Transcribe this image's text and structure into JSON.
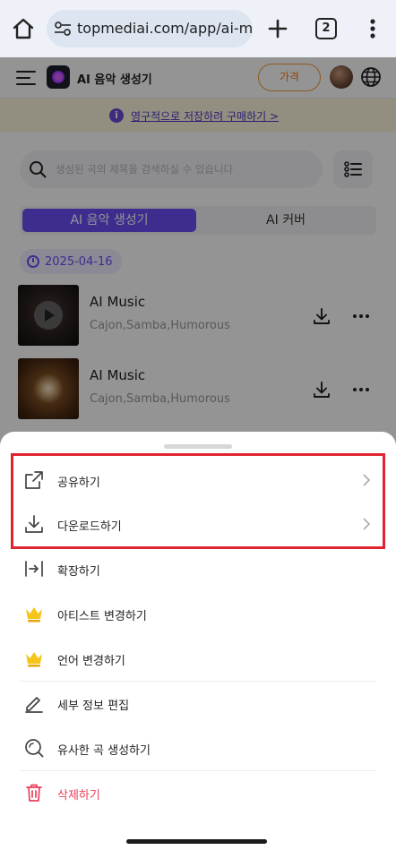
{
  "browser": {
    "url": "topmediai.com/app/ai-m",
    "tab_count": "2"
  },
  "app": {
    "title": "AI 음악 생성기",
    "price_button": "가격",
    "banner_text": "영구적으로 저장하려 구매하기 >",
    "search_placeholder": "생성된 곡의 제목을 검색하실 수 있습니다",
    "tabs": [
      {
        "label": "AI 음악 생성기",
        "active": true
      },
      {
        "label": "AI 커버",
        "active": false
      }
    ],
    "date": "2025-04-16",
    "songs": [
      {
        "title": "AI Music",
        "tags": "Cajon,Samba,Humorous"
      },
      {
        "title": "AI Music",
        "tags": "Cajon,Samba,Humorous"
      }
    ]
  },
  "sheet": {
    "items": [
      {
        "label": "공유하기",
        "icon": "share-icon"
      },
      {
        "label": "다운로드하기",
        "icon": "download-icon"
      },
      {
        "label": "확장하기",
        "icon": "extend-icon"
      },
      {
        "label": "아티스트 변경하기",
        "icon": "crown-icon"
      },
      {
        "label": "언어 변경하기",
        "icon": "crown-icon"
      },
      {
        "label": "세부 정보 편집",
        "icon": "pencil-icon"
      },
      {
        "label": "유사한 곡 생성하기",
        "icon": "similar-search-icon"
      },
      {
        "label": "삭제하기",
        "icon": "trash-icon"
      }
    ]
  },
  "colors": {
    "accent": "#6c4ff5",
    "price": "#f07a1e",
    "danger": "#e8405a",
    "highlight": "#e0242f",
    "crown": "#f5c518"
  }
}
